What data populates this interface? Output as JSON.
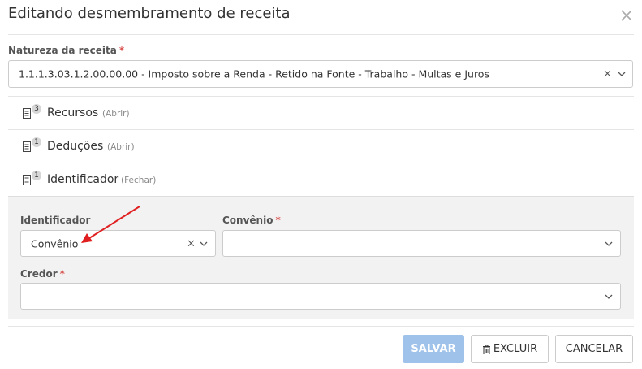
{
  "modal": {
    "title": "Editando desmembramento de receita",
    "close_glyph": "×"
  },
  "natureza": {
    "label": "Natureza da receita",
    "required_mark": "*",
    "value": "1.1.1.3.03.1.2.00.00.00 - Imposto sobre a Renda - Retido na Fonte - Trabalho - Multas e Juros",
    "clear_glyph": "×"
  },
  "sections": [
    {
      "name": "Recursos",
      "count": "3",
      "toggle": "(Abrir)"
    },
    {
      "name": "Deduções",
      "count": "1",
      "toggle": "(Abrir)"
    },
    {
      "name": "Identificador",
      "count": "1",
      "toggle": "(Fechar)"
    }
  ],
  "identificador_panel": {
    "identificador_label": "Identificador",
    "identificador_value": "Convênio",
    "clear_glyph": "×",
    "convenio_label": "Convênio",
    "convenio_required_mark": "*",
    "convenio_value": "",
    "credor_label": "Credor",
    "credor_required_mark": "*",
    "credor_value": ""
  },
  "footer": {
    "save_label": "SALVAR",
    "delete_label": "EXCLUIR",
    "cancel_label": "CANCELAR"
  },
  "colors": {
    "save_button": "#9fc2ea",
    "required": "#d9534f",
    "annotation_arrow": "#e02020"
  },
  "icons": {
    "close": "close-icon",
    "clear": "clear-icon",
    "chevron": "chevron-down-icon",
    "section": "document-icon",
    "delete": "trash-icon"
  }
}
